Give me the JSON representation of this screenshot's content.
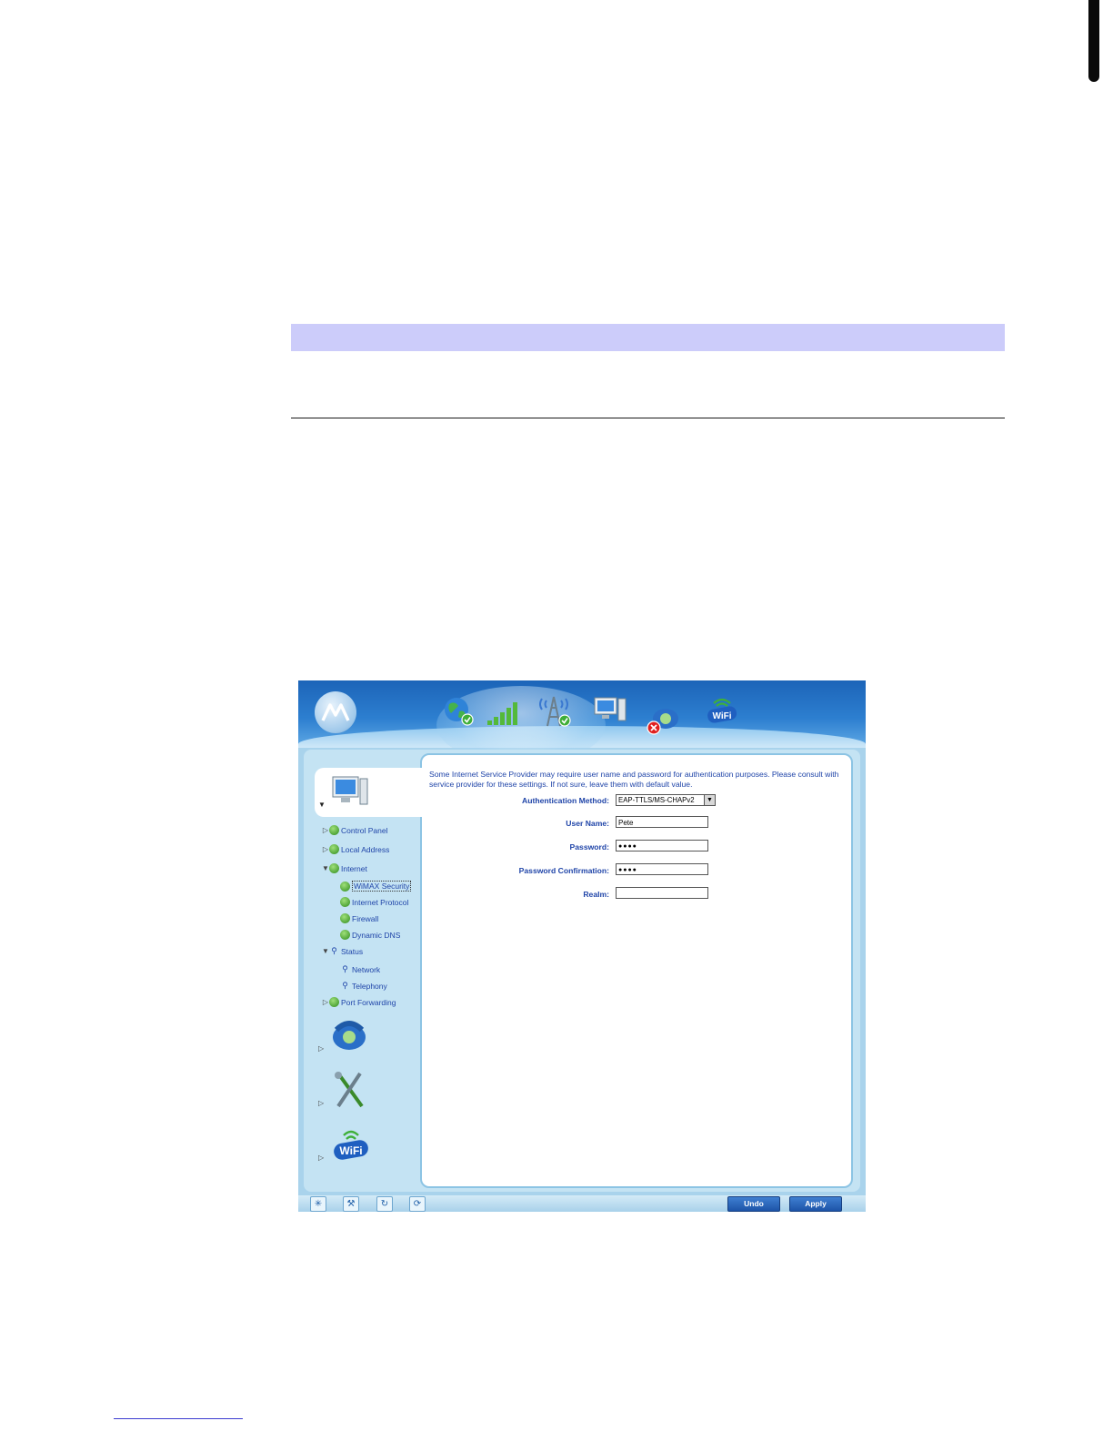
{
  "router_ui": {
    "description": "Some Internet Service Provider may require user name and password for authentication purposes. Please consult with service provider for these settings. If not sure, leave them with default value.",
    "form": {
      "auth_method_label": "Authentication Method:",
      "auth_method_value": "EAP-TTLS/MS-CHAPv2",
      "username_label": "User Name:",
      "username_value": "Pete",
      "password_label": "Password:",
      "password_value": "●●●●",
      "password_confirm_label": "Password Confirmation:",
      "password_confirm_value": "●●●●",
      "realm_label": "Realm:",
      "realm_value": ""
    },
    "sidebar": {
      "control_panel": "Control Panel",
      "local_address": "Local Address",
      "internet": "Internet",
      "wimax_security": "WiMAX Security",
      "internet_protocol": "Internet Protocol",
      "firewall": "Firewall",
      "dynamic_dns": "Dynamic DNS",
      "status": "Status",
      "network": "Network",
      "telephony": "Telephony",
      "port_forwarding": "Port Forwarding"
    },
    "buttons": {
      "undo": "Undo",
      "apply": "Apply"
    },
    "banner_icons": [
      "globe-icon",
      "signal-bars-icon",
      "tower-icon",
      "computer-icon",
      "telephone-icon",
      "wifi-icon"
    ],
    "wifi_text": "WiFi",
    "colors": {
      "banner": "#2d7fd0",
      "note_band": "#ccccfa",
      "link_text": "#1f44a8",
      "button": "#1d54a8"
    }
  }
}
